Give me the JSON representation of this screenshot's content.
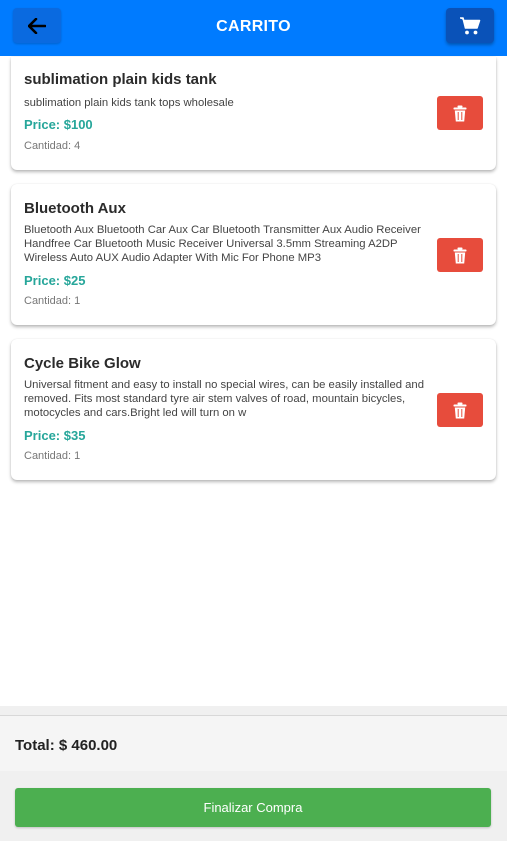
{
  "header": {
    "title": "CARRITO",
    "back_icon": "arrow-left-icon",
    "cart_icon": "shopping-cart-icon"
  },
  "cart": {
    "items": [
      {
        "name": "sublimation plain kids tank",
        "description": "sublimation plain kids tank tops wholesale",
        "price": "Price: $100",
        "quantity": "Cantidad: 4"
      },
      {
        "name": "Bluetooth Aux",
        "description": "Bluetooth Aux Bluetooth Car Aux Car Bluetooth Transmitter Aux Audio Receiver Handfree Car Bluetooth Music Receiver Universal 3.5mm Streaming A2DP Wireless Auto AUX Audio Adapter With Mic For Phone MP3",
        "price": "Price: $25",
        "quantity": "Cantidad: 1"
      },
      {
        "name": "Cycle Bike Glow",
        "description": "Universal fitment and easy to install no special wires, can be easily installed and removed. Fits most standard tyre air stem valves of road, mountain bicycles, motocycles and cars.Bright led will turn on w",
        "price": "Price: $35",
        "quantity": "Cantidad: 1"
      }
    ],
    "delete_icon": "trash-icon"
  },
  "footer": {
    "total": "Total: $ 460.00",
    "checkout_label": "Finalizar Compra"
  },
  "colors": {
    "header": "#007bff",
    "price": "#26a69a",
    "delete": "#e74c3c",
    "checkout": "#4caf50"
  }
}
